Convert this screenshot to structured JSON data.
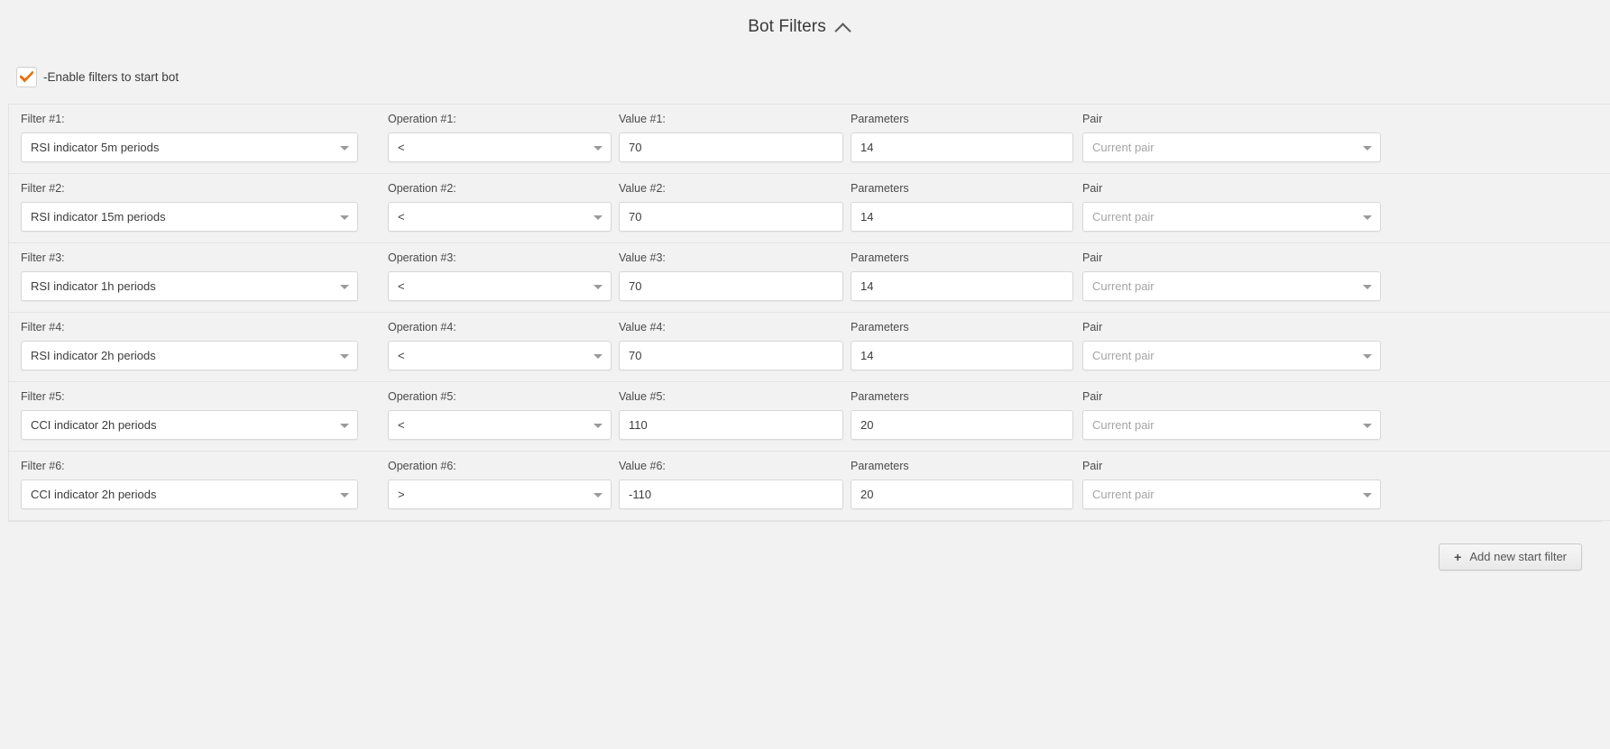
{
  "panel": {
    "title": "Bot Filters",
    "collapse_icon": "chevron-up-icon"
  },
  "enable": {
    "label": "-Enable filters to start bot",
    "checked": true,
    "check_color": "#e8700f"
  },
  "columns": {
    "filter": "Filter",
    "operation": "Operation",
    "value": "Value",
    "parameters": "Parameters",
    "pair": "Pair"
  },
  "rows": [
    {
      "filter_label": "Filter #1:",
      "filter_value": "RSI indicator 5m periods",
      "operation_label": "Operation #1:",
      "operation_value": "<",
      "value_label": "Value #1:",
      "value_value": "70",
      "parameters_label": "Parameters",
      "parameters_value": "14",
      "pair_label": "Pair",
      "pair_placeholder": "Current pair"
    },
    {
      "filter_label": "Filter #2:",
      "filter_value": "RSI indicator 15m periods",
      "operation_label": "Operation #2:",
      "operation_value": "<",
      "value_label": "Value #2:",
      "value_value": "70",
      "parameters_label": "Parameters",
      "parameters_value": "14",
      "pair_label": "Pair",
      "pair_placeholder": "Current pair"
    },
    {
      "filter_label": "Filter #3:",
      "filter_value": "RSI indicator 1h periods",
      "operation_label": "Operation #3:",
      "operation_value": "<",
      "value_label": "Value #3:",
      "value_value": "70",
      "parameters_label": "Parameters",
      "parameters_value": "14",
      "pair_label": "Pair",
      "pair_placeholder": "Current pair"
    },
    {
      "filter_label": "Filter #4:",
      "filter_value": "RSI indicator 2h periods",
      "operation_label": "Operation #4:",
      "operation_value": "<",
      "value_label": "Value #4:",
      "value_value": "70",
      "parameters_label": "Parameters",
      "parameters_value": "14",
      "pair_label": "Pair",
      "pair_placeholder": "Current pair"
    },
    {
      "filter_label": "Filter #5:",
      "filter_value": "CCI indicator 2h periods",
      "operation_label": "Operation #5:",
      "operation_value": "<",
      "value_label": "Value #5:",
      "value_value": "110",
      "parameters_label": "Parameters",
      "parameters_value": "20",
      "pair_label": "Pair",
      "pair_placeholder": "Current pair"
    },
    {
      "filter_label": "Filter #6:",
      "filter_value": "CCI indicator 2h periods",
      "operation_label": "Operation #6:",
      "operation_value": ">",
      "value_label": "Value #6:",
      "value_value": "-110",
      "parameters_label": "Parameters",
      "parameters_value": "20",
      "pair_label": "Pair",
      "pair_placeholder": "Current pair"
    }
  ],
  "footer": {
    "add_button_label": "Add new start filter",
    "add_button_icon": "plus-icon"
  }
}
